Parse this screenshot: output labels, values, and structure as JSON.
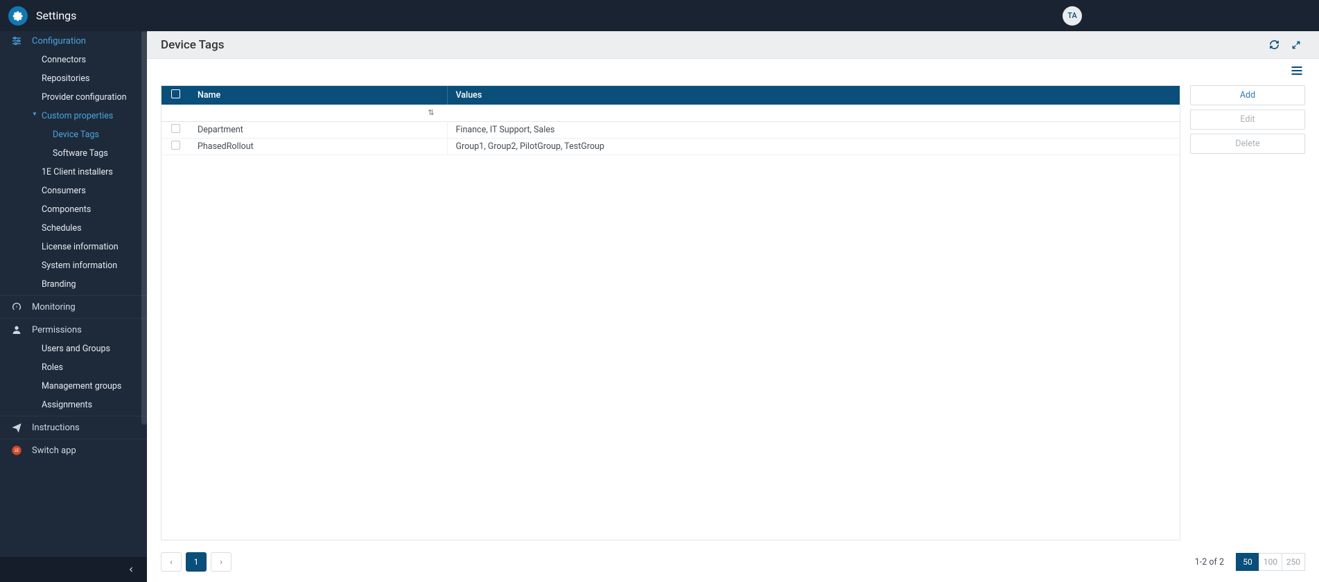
{
  "app": {
    "title": "Settings",
    "user_initials": "TA"
  },
  "sidebar": {
    "configuration": "Configuration",
    "items": {
      "connectors": "Connectors",
      "repositories": "Repositories",
      "provider": "Provider configuration",
      "custom_properties": "Custom properties",
      "device_tags": "Device Tags",
      "software_tags": "Software Tags",
      "client_installers": "1E Client installers",
      "consumers": "Consumers",
      "components": "Components",
      "schedules": "Schedules",
      "license": "License information",
      "system": "System information",
      "branding": "Branding"
    },
    "monitoring": "Monitoring",
    "permissions": "Permissions",
    "perm_items": {
      "users_groups": "Users and Groups",
      "roles": "Roles",
      "mgmt_groups": "Management groups",
      "assignments": "Assignments"
    },
    "instructions": "Instructions",
    "switch_app": "Switch app"
  },
  "page": {
    "title": "Device Tags"
  },
  "table": {
    "columns": {
      "name": "Name",
      "values": "Values"
    },
    "rows": [
      {
        "name": "Department",
        "values": "Finance, IT Support, Sales"
      },
      {
        "name": "PhasedRollout",
        "values": "Group1, Group2, PilotGroup, TestGroup"
      }
    ]
  },
  "actions": {
    "add": "Add",
    "edit": "Edit",
    "delete": "Delete"
  },
  "pager": {
    "prev": "‹",
    "page": "1",
    "next": "›",
    "info": "1-2 of 2",
    "sizes": {
      "s50": "50",
      "s100": "100",
      "s250": "250"
    }
  }
}
